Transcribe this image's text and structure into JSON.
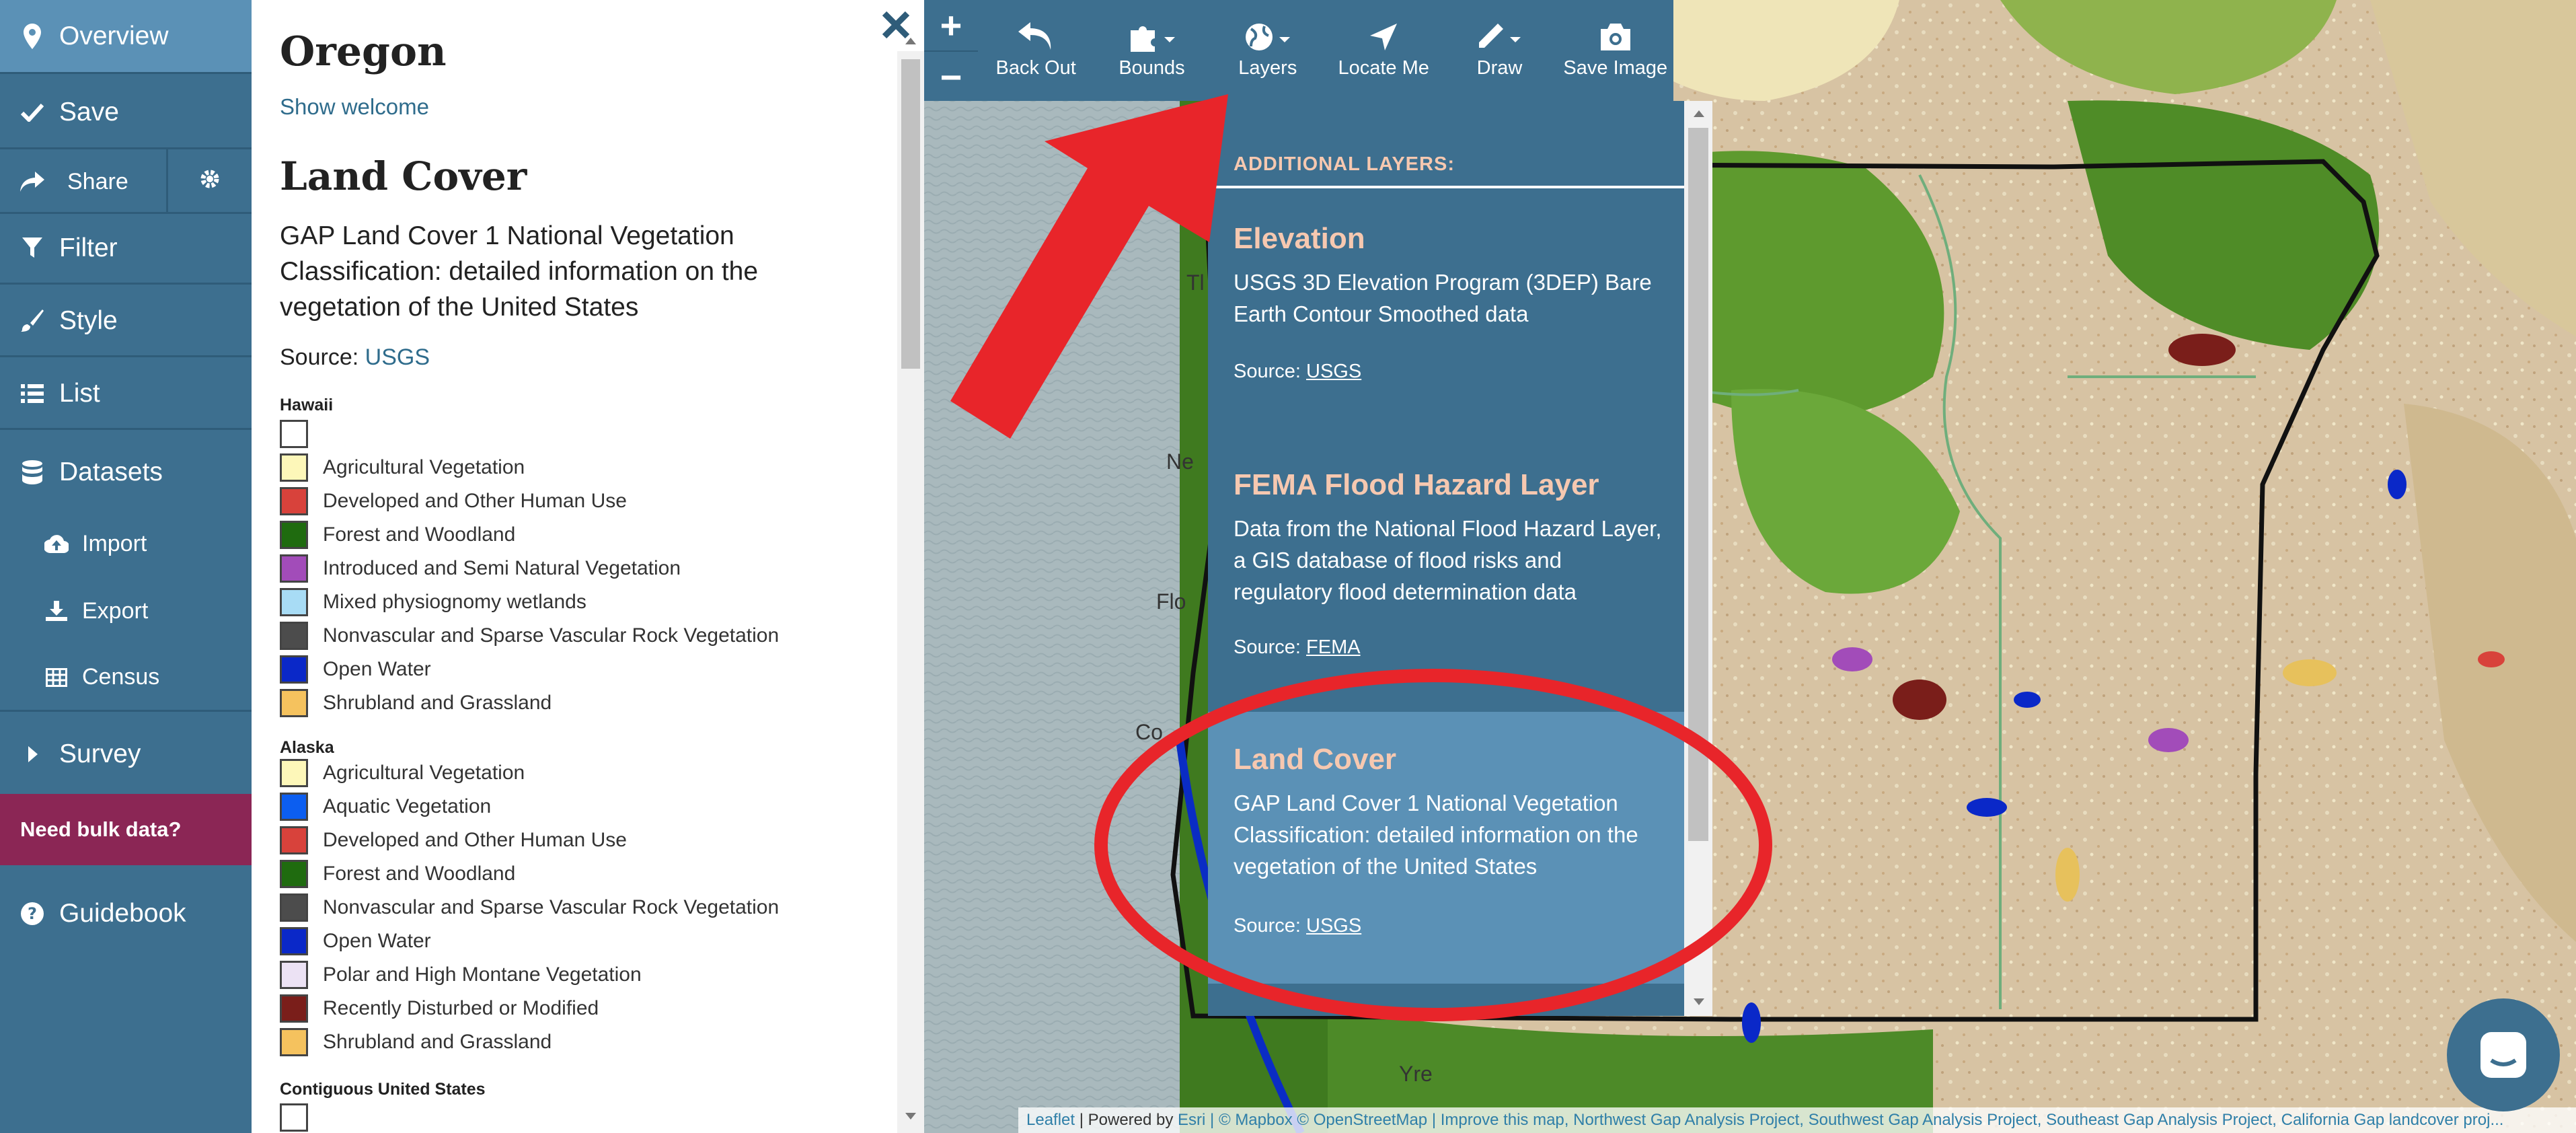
{
  "nav": {
    "overview": "Overview",
    "save": "Save",
    "share": "Share",
    "filter": "Filter",
    "style": "Style",
    "list": "List",
    "datasets": "Datasets",
    "import": "Import",
    "export": "Export",
    "census": "Census",
    "survey": "Survey",
    "bulk": "Need bulk data?",
    "guidebook": "Guidebook"
  },
  "panel": {
    "title": "Oregon",
    "show_welcome": "Show welcome",
    "layer_title": "Land Cover",
    "layer_desc": "GAP Land Cover 1 National Vegetation Classification: detailed information on the vegetation of the United States",
    "source_label": "Source:",
    "source_link": "USGS",
    "legend": {
      "hawaii_label": "Hawaii",
      "alaska_label": "Alaska",
      "contiguous_label": "Contiguous United States",
      "hawaii": [
        {
          "label": "",
          "color": "#ffffff"
        },
        {
          "label": "Agricultural Vegetation",
          "color": "#fdf7b9"
        },
        {
          "label": "Developed and Other Human Use",
          "color": "#d8423b"
        },
        {
          "label": "Forest and Woodland",
          "color": "#1f6b0f"
        },
        {
          "label": "Introduced and Semi Natural Vegetation",
          "color": "#a24cb9"
        },
        {
          "label": "Mixed physiognomy wetlands",
          "color": "#a8dcf5"
        },
        {
          "label": "Nonvascular and Sparse Vascular Rock Vegetation",
          "color": "#4c4c4c"
        },
        {
          "label": "Open Water",
          "color": "#0a28c8"
        },
        {
          "label": "Shrubland and Grassland",
          "color": "#f5c25e"
        }
      ],
      "alaska": [
        {
          "label": "Agricultural Vegetation",
          "color": "#fdf7b9"
        },
        {
          "label": "Aquatic Vegetation",
          "color": "#0c5ef0"
        },
        {
          "label": "Developed and Other Human Use",
          "color": "#d8423b"
        },
        {
          "label": "Forest and Woodland",
          "color": "#1f6b0f"
        },
        {
          "label": "Nonvascular and Sparse Vascular Rock Vegetation",
          "color": "#4c4c4c"
        },
        {
          "label": "Open Water",
          "color": "#0a28c8"
        },
        {
          "label": "Polar and High Montane Vegetation",
          "color": "#ece2f4"
        },
        {
          "label": "Recently Disturbed or Modified",
          "color": "#7a1e1a"
        },
        {
          "label": "Shrubland and Grassland",
          "color": "#f5c25e"
        }
      ],
      "contiguous": [
        {
          "label": "",
          "color": "#ffffff"
        }
      ]
    }
  },
  "toolbar": {
    "zoom_in": "+",
    "zoom_out": "−",
    "back_out": "Back Out",
    "bounds": "Bounds",
    "layers": "Layers",
    "locate_me": "Locate Me",
    "draw": "Draw",
    "save_image": "Save Image"
  },
  "layers_menu": {
    "header": "ADDITIONAL LAYERS:",
    "items": [
      {
        "title": "Elevation",
        "desc": "USGS 3D Elevation Program (3DEP) Bare Earth Contour Smoothed data",
        "source_label": "Source:",
        "source": "USGS"
      },
      {
        "title": "FEMA Flood Hazard Layer",
        "desc": "Data from the National Flood Hazard Layer, a GIS database of flood risks and regulatory flood determination data",
        "source_label": "Source:",
        "source": "FEMA"
      },
      {
        "title": "Land Cover",
        "desc": "GAP Land Cover 1 National Vegetation Classification: detailed information on the vegetation of the United States",
        "source_label": "Source:",
        "source": "USGS"
      }
    ]
  },
  "map": {
    "place_labels": [
      "Ne",
      "Flo",
      "Co",
      "Tl",
      "Yre"
    ]
  },
  "attribution": {
    "leaflet": "Leaflet",
    "powered": " | Powered by ",
    "esri": "Esri",
    "rest": " | © Mapbox © OpenStreetMap | Improve this map, Northwest Gap Analysis Project, Southwest Gap Analysis Project, Southeast Gap Analysis Project, California Gap landcover proj..."
  },
  "colors": {
    "nav_bg": "#3d6f8f",
    "nav_active": "#5b91b6",
    "bulk_bg": "#8b2655",
    "layer_title": "#f6c8b0",
    "annotation_red": "#e8252a"
  }
}
